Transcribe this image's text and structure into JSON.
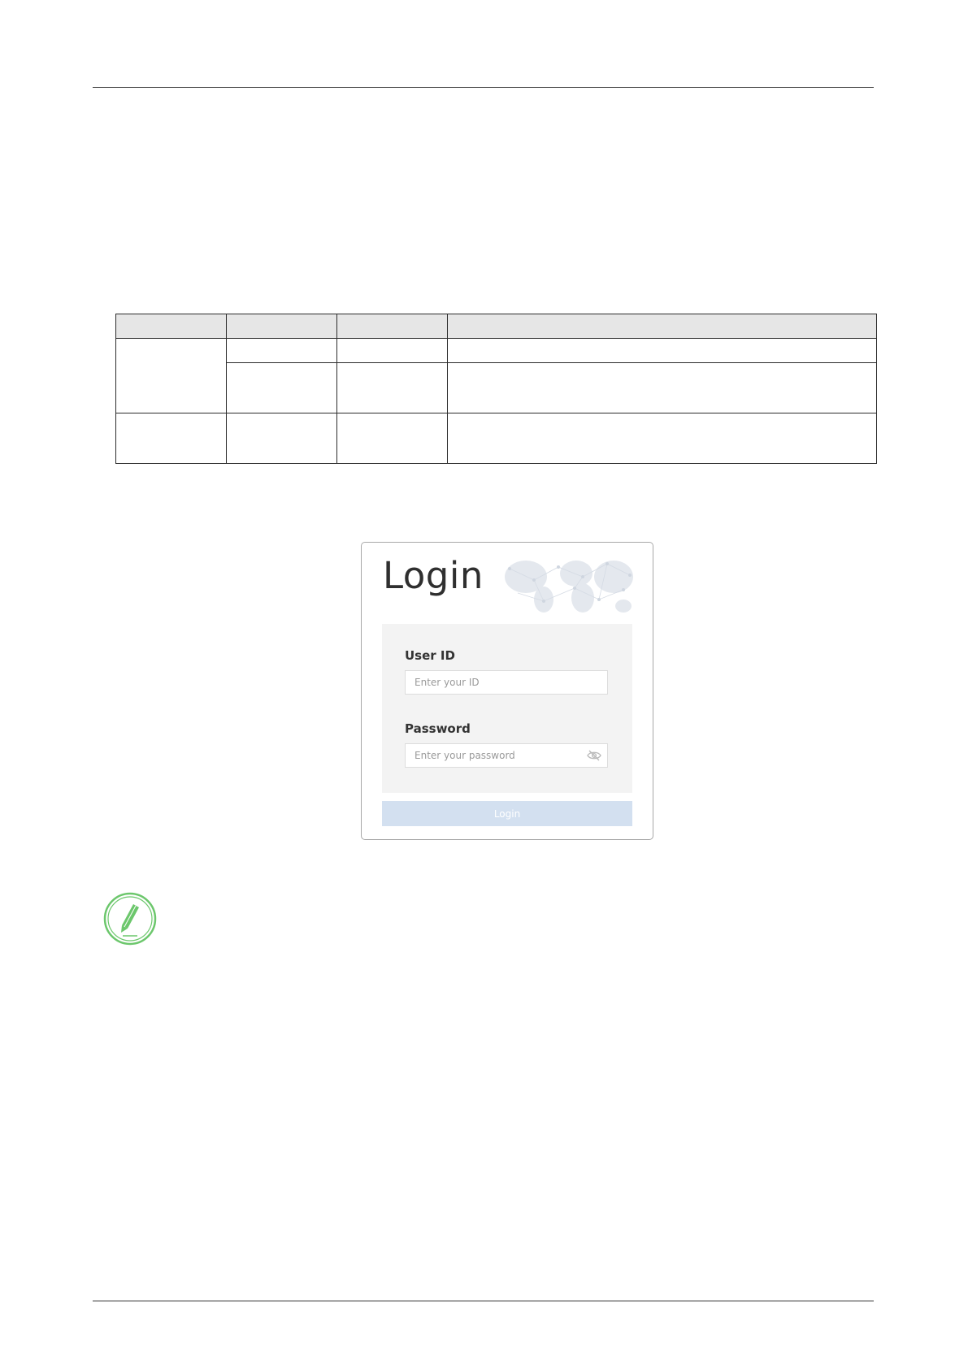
{
  "colors": {
    "rule": "#333333",
    "table_header_bg": "#e6e6e6",
    "login_button_bg": "#d3e0f0",
    "form_box_bg": "#f3f3f3",
    "note_icon": "#6cc76c"
  },
  "table": {
    "header": [
      "",
      "",
      "",
      ""
    ],
    "rows": [
      [
        "",
        "",
        "",
        ""
      ],
      [
        "",
        "",
        ""
      ],
      [
        "",
        "",
        "",
        ""
      ]
    ]
  },
  "login": {
    "title": "Login",
    "user_id_label": "User ID",
    "user_id_placeholder": "Enter your ID",
    "password_label": "Password",
    "password_placeholder": "Enter your password",
    "button_label": "Login",
    "password_toggle_icon": "eye-slash-icon",
    "background_icon": "world-map"
  },
  "note": {
    "icon": "pencil-icon"
  }
}
